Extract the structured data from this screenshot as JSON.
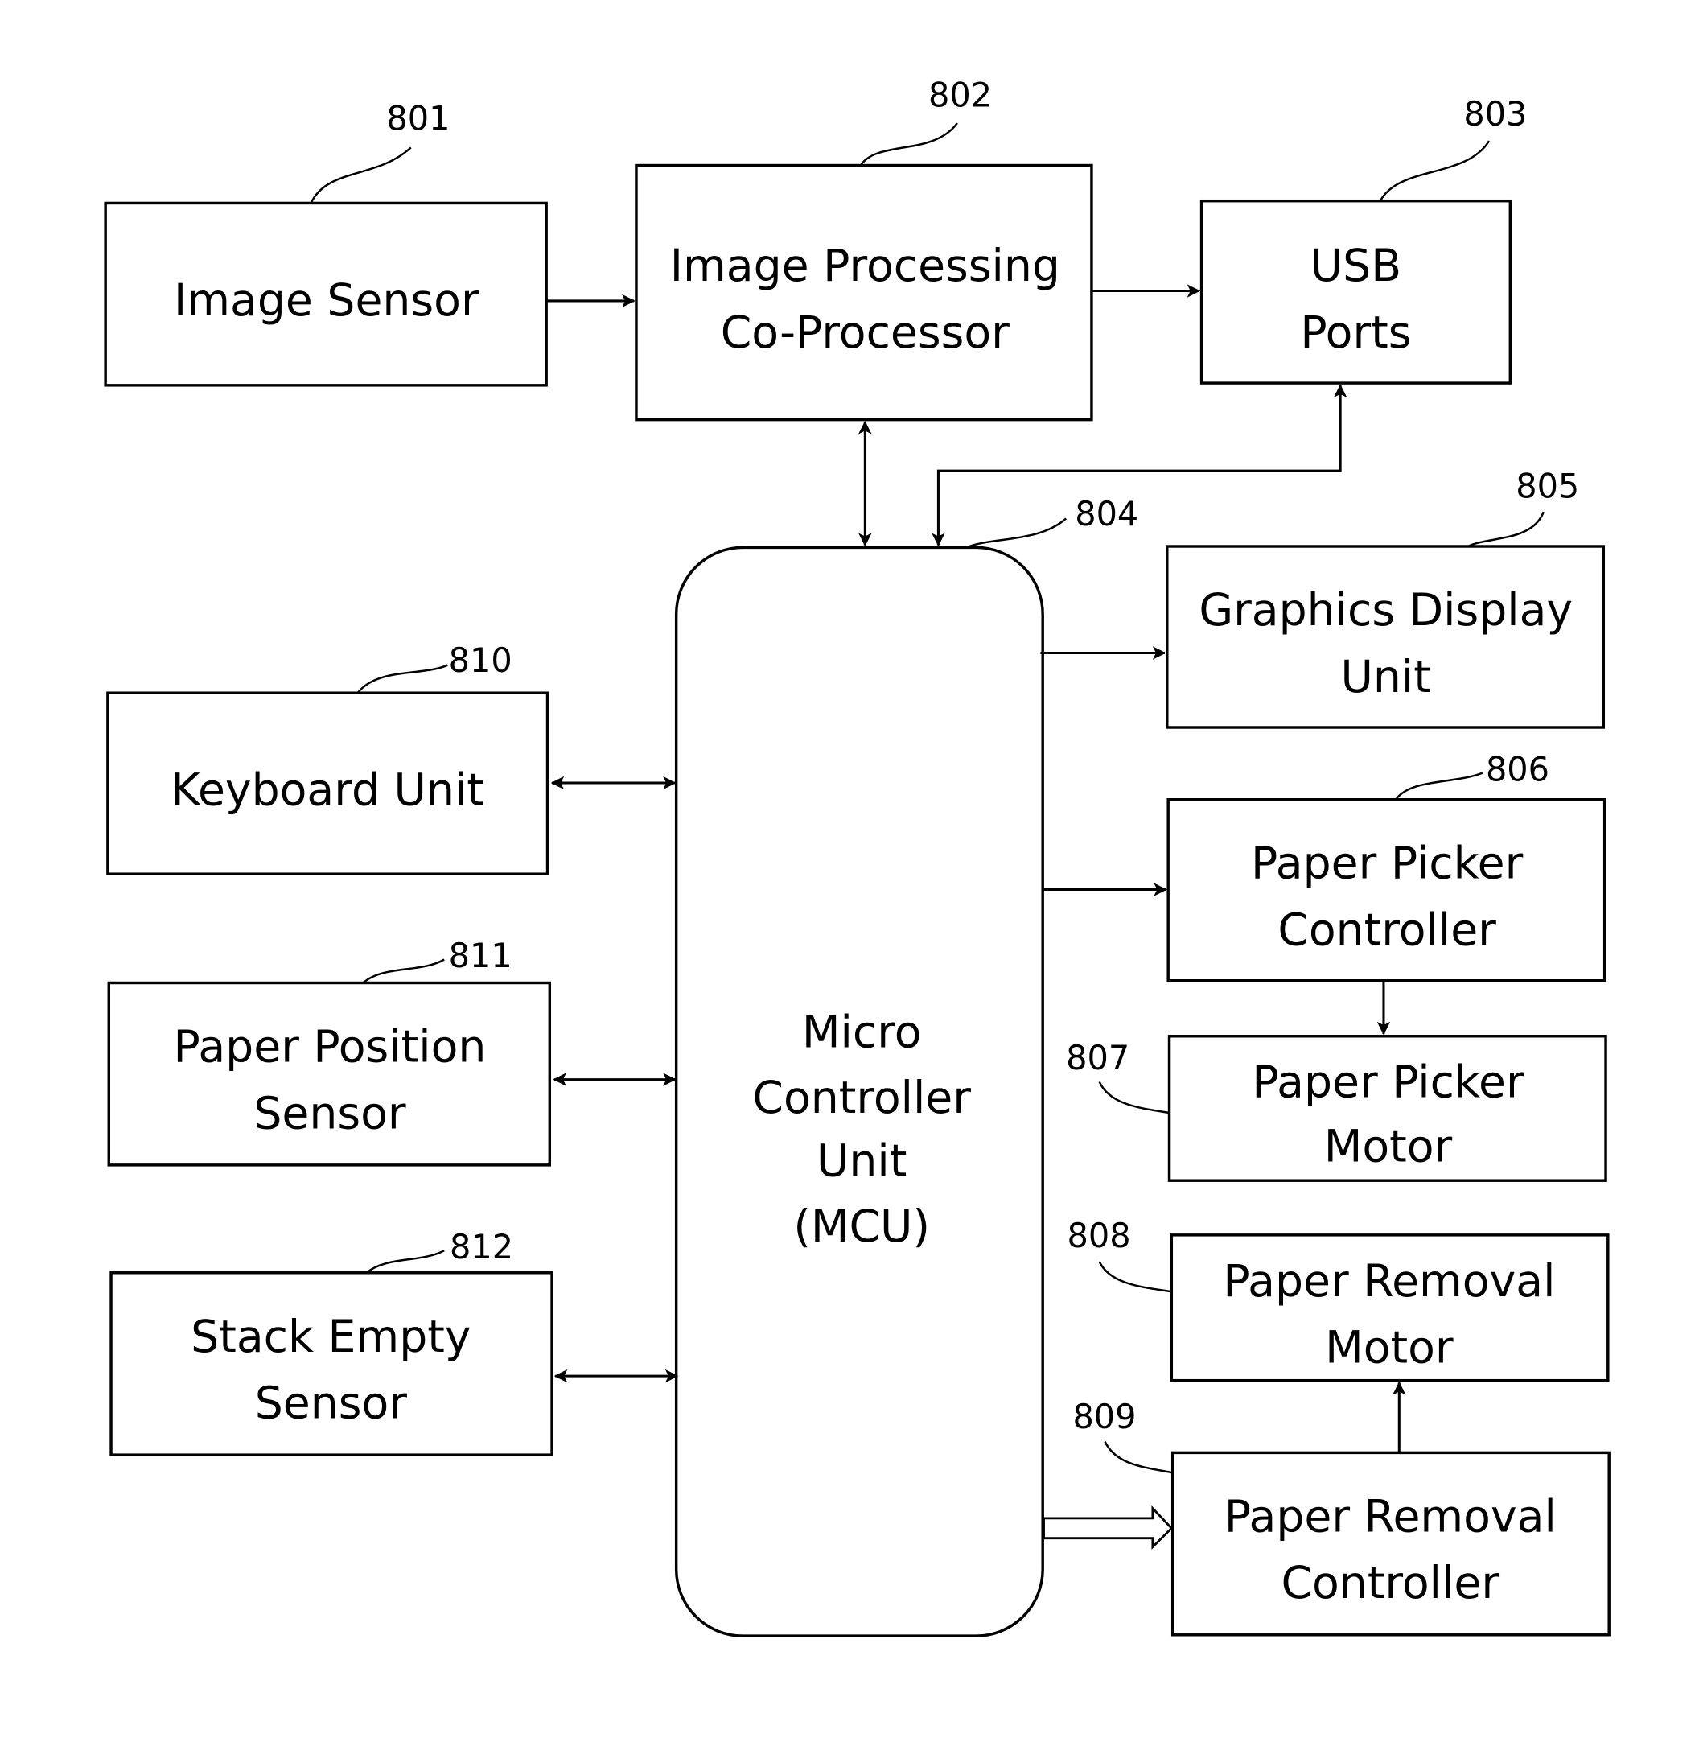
{
  "figure": {
    "blocks": {
      "image_sensor": {
        "ref": "801",
        "lines": [
          "Image Sensor"
        ]
      },
      "image_processing": {
        "ref": "802",
        "lines": [
          "Image Processing",
          "Co-Processor"
        ]
      },
      "usb_ports": {
        "ref": "803",
        "lines": [
          "USB",
          "Ports"
        ]
      },
      "mcu": {
        "ref": "804",
        "lines": [
          "Micro",
          "Controller",
          "Unit",
          "(MCU)"
        ]
      },
      "graphics_display": {
        "ref": "805",
        "lines": [
          "Graphics Display",
          "Unit"
        ]
      },
      "paper_picker_controller": {
        "ref": "806",
        "lines": [
          "Paper Picker",
          "Controller"
        ]
      },
      "paper_picker_motor": {
        "ref": "807",
        "lines": [
          "Paper Picker",
          "Motor"
        ]
      },
      "paper_removal_motor": {
        "ref": "808",
        "lines": [
          "Paper Removal",
          "Motor"
        ]
      },
      "paper_removal_controller": {
        "ref": "809",
        "lines": [
          "Paper Removal",
          "Controller"
        ]
      },
      "keyboard_unit": {
        "ref": "810",
        "lines": [
          "Keyboard Unit"
        ]
      },
      "paper_position_sensor": {
        "ref": "811",
        "lines": [
          "Paper Position",
          "Sensor"
        ]
      },
      "stack_empty_sensor": {
        "ref": "812",
        "lines": [
          "Stack Empty",
          "Sensor"
        ]
      }
    }
  }
}
